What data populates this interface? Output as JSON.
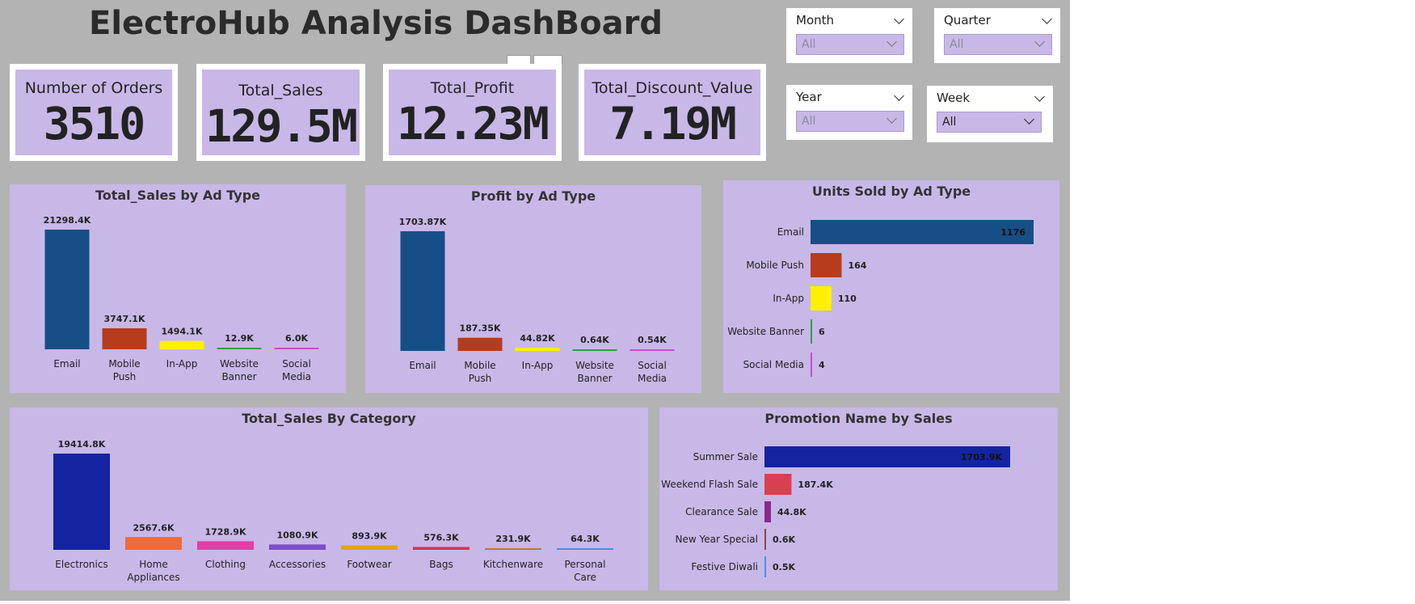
{
  "title": "ElectroHub Analysis DashBoard",
  "kpis": [
    {
      "label": "Number of Orders",
      "value": "3510"
    },
    {
      "label": "Total_Sales",
      "value": "129.5M"
    },
    {
      "label": "Total_Profit",
      "value": "12.23M"
    },
    {
      "label": "Total_Discount_Value",
      "value": "7.19M"
    }
  ],
  "slicers": [
    {
      "label": "Month",
      "value": "All"
    },
    {
      "label": "Quarter",
      "value": "All"
    },
    {
      "label": "Year",
      "value": "All"
    },
    {
      "label": "Week",
      "value": "All"
    }
  ],
  "colors": {
    "canvas": "#b3b3b3",
    "panel": "#c8b8e8",
    "email": "#164f86",
    "mobile_push": "#b63c1c",
    "in_app": "#ffef00",
    "website_banner": "#2e9e4a",
    "social_media": "#c44fc8"
  },
  "chart_data": [
    {
      "type": "bar",
      "title": "Total_Sales by Ad Type",
      "categories": [
        "Email",
        "Mobile Push",
        "In-App",
        "Website Banner",
        "Social Media"
      ],
      "values": [
        21298.4,
        3747.1,
        1494.1,
        12.9,
        6.0
      ],
      "labels": [
        "21298.4K",
        "3747.1K",
        "1494.1K",
        "12.9K",
        "6.0K"
      ],
      "colors": [
        "#164f86",
        "#b63c1c",
        "#ffef00",
        "#2e9e4a",
        "#c44fc8"
      ]
    },
    {
      "type": "bar",
      "title": "Profit by Ad Type",
      "categories": [
        "Email",
        "Mobile Push",
        "In-App",
        "Website Banner",
        "Social Media"
      ],
      "values": [
        1703.87,
        187.35,
        44.82,
        0.64,
        0.54
      ],
      "labels": [
        "1703.87K",
        "187.35K",
        "44.82K",
        "0.64K",
        "0.54K"
      ],
      "colors": [
        "#164f86",
        "#b63c1c",
        "#ffef00",
        "#2e9e4a",
        "#c44fc8"
      ]
    },
    {
      "type": "bar",
      "orientation": "horizontal",
      "title": "Units Sold by Ad Type",
      "categories": [
        "Email",
        "Mobile Push",
        "In-App",
        "Website Banner",
        "Social Media"
      ],
      "values": [
        1176,
        164,
        110,
        6,
        4
      ],
      "labels": [
        "1176",
        "164",
        "110",
        "6",
        "4"
      ],
      "colors": [
        "#164f86",
        "#b63c1c",
        "#ffef00",
        "#2e9e4a",
        "#c44fc8"
      ]
    },
    {
      "type": "bar",
      "title": "Total_Sales By Category",
      "categories": [
        "Electronics",
        "Home Appliances",
        "Clothing",
        "Accessories",
        "Footwear",
        "Bags",
        "Kitchenware",
        "Personal Care"
      ],
      "values": [
        19414.8,
        2567.6,
        1728.9,
        1080.9,
        893.9,
        576.3,
        231.9,
        64.3
      ],
      "labels": [
        "19414.8K",
        "2567.6K",
        "1728.9K",
        "1080.9K",
        "893.9K",
        "576.3K",
        "231.9K",
        "64.3K"
      ],
      "colors": [
        "#1424a0",
        "#ee6b3b",
        "#e040a8",
        "#7a4fc8",
        "#e0a800",
        "#d8344a",
        "#c07830",
        "#4a8ee8"
      ]
    },
    {
      "type": "bar",
      "orientation": "horizontal",
      "title": "Promotion Name by Sales",
      "categories": [
        "Summer Sale",
        "Weekend Flash Sale",
        "Clearance Sale",
        "New Year Special",
        "Festive Diwali"
      ],
      "values": [
        1703.9,
        187.4,
        44.8,
        0.6,
        0.5
      ],
      "labels": [
        "1703.9K",
        "187.4K",
        "44.8K",
        "0.6K",
        "0.5K"
      ],
      "colors": [
        "#1424a0",
        "#d84050",
        "#8a2a8a",
        "#8a4a4a",
        "#4a8ee8"
      ]
    }
  ]
}
